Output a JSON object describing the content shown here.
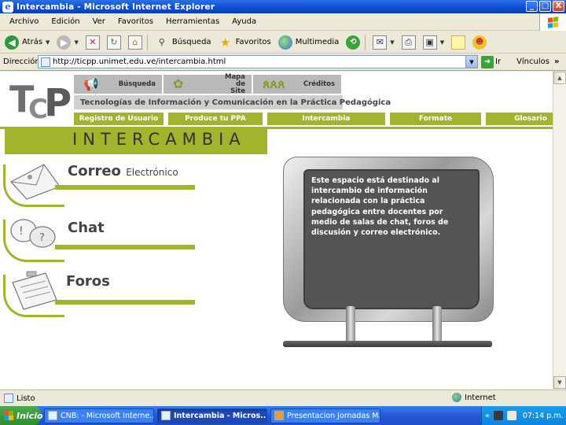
{
  "window": {
    "title": "Intercambia - Microsoft Internet Explorer",
    "buttons": [
      "_",
      "□",
      "X"
    ]
  },
  "menu": [
    "Archivo",
    "Edición",
    "Ver",
    "Favoritos",
    "Herramientas",
    "Ayuda"
  ],
  "toolbar": {
    "back": "Atrás",
    "search": "Búsqueda",
    "favorites": "Favoritos",
    "multimedia": "Multimedia"
  },
  "address": {
    "label": "Dirección",
    "url": "http://ticpp.unimet.edu.ve/intercambia.html",
    "go": "Ir",
    "links": "Vínculos",
    "more": "»"
  },
  "site": {
    "logo": {
      "t": "T",
      "c": "C",
      "p": "P"
    },
    "topnav": [
      {
        "label": "Búsqueda",
        "icon": "megaphone-icon"
      },
      {
        "label": "Mapa de Site",
        "icon": "people-map-icon"
      },
      {
        "label": "Créditos",
        "icon": "people-icon"
      }
    ],
    "banner": "Tecnologías de Información y Comunicación en la Práctica Pedagógica",
    "nav": [
      "Registro de Usuario",
      "Produce tu PPA",
      "Intercambia",
      "Formate",
      "Glosario"
    ],
    "page_title": "INTERCAMBIA",
    "sections": [
      {
        "title": "Correo",
        "subtitle": "Electrónico",
        "icon": "envelope-icon"
      },
      {
        "title": "Chat",
        "subtitle": "",
        "icon": "chat-bubbles-icon"
      },
      {
        "title": "Foros",
        "subtitle": "",
        "icon": "clipboard-icon"
      }
    ],
    "monitor_text": "Este espacio está destinado al intercambio de información relacionada con la práctica pedagógica entre docentes por medio de salas de  chat, foros de discusión y correo electrónico."
  },
  "status": {
    "text": "Listo",
    "zone": "Internet"
  },
  "taskbar": {
    "start": "Inicio",
    "tasks": [
      {
        "label": "CNB: - Microsoft Interne...",
        "active": false
      },
      {
        "label": "Intercambia - Micros...",
        "active": true
      },
      {
        "label": "Presentacion Jornadas M...",
        "active": false
      }
    ],
    "clock": "07:14 p.m.",
    "tray_chevron": "«"
  },
  "colors": {
    "accent_green": "#a3b42c",
    "xp_blue": "#2459d6",
    "screen_gray": "#545454"
  }
}
